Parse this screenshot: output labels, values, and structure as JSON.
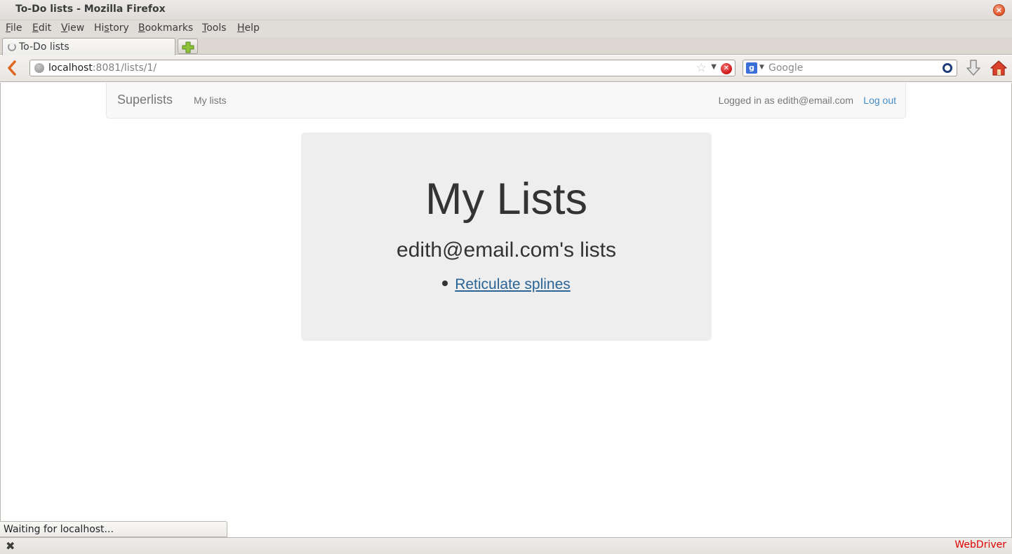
{
  "window": {
    "title": "To-Do lists - Mozilla Firefox",
    "close_icon": "close-icon"
  },
  "menubar": {
    "items": [
      {
        "label": "File",
        "accel": "F",
        "rest": "ile"
      },
      {
        "label": "Edit",
        "accel": "E",
        "rest": "dit"
      },
      {
        "label": "View",
        "accel": "V",
        "rest": "iew"
      },
      {
        "label": "History",
        "pre": "Hi",
        "accel": "s",
        "rest": "tory"
      },
      {
        "label": "Bookmarks",
        "accel": "B",
        "rest": "ookmarks"
      },
      {
        "label": "Tools",
        "accel": "T",
        "rest": "ools"
      },
      {
        "label": "Help",
        "accel": "H",
        "rest": "elp"
      }
    ]
  },
  "tabs": [
    {
      "label": "To-Do lists",
      "loading": true
    }
  ],
  "navbar": {
    "url_host": "localhost",
    "url_rest": ":8081/lists/1/",
    "search_placeholder": "Google",
    "search_engine_letter": "g"
  },
  "site": {
    "brand": "Superlists",
    "nav_link": "My lists",
    "logged_in_text": "Logged in as edith@email.com",
    "logout_label": "Log out",
    "link_color": "#428bca"
  },
  "jumbotron": {
    "heading": "My Lists",
    "subheading": "edith@email.com's lists",
    "lists": [
      {
        "name": "Reticulate splines"
      }
    ]
  },
  "status": {
    "loading_text": "Waiting for localhost...",
    "webdriver_label": "WebDriver",
    "webdriver_color": "#e10000"
  }
}
